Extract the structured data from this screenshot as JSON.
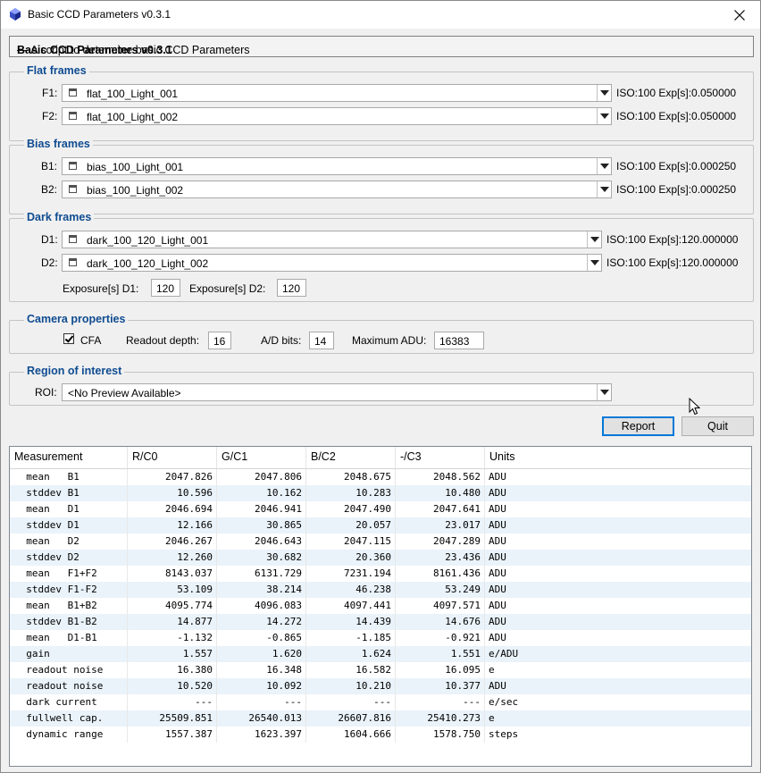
{
  "window": {
    "title": "Basic CCD Parameters v0.3.1"
  },
  "header": {
    "title": "Basic CCD Parameters v0.3.1",
    "dash": " — A script to determine basic CCD Parameters"
  },
  "flat": {
    "title": "Flat frames",
    "rows": [
      {
        "label": "F1:",
        "value": "flat_100_Light_001",
        "info": "ISO:100 Exp[s]:0.050000"
      },
      {
        "label": "F2:",
        "value": "flat_100_Light_002",
        "info": "ISO:100 Exp[s]:0.050000"
      }
    ]
  },
  "bias": {
    "title": "Bias frames",
    "rows": [
      {
        "label": "B1:",
        "value": "bias_100_Light_001",
        "info": "ISO:100 Exp[s]:0.000250"
      },
      {
        "label": "B2:",
        "value": "bias_100_Light_002",
        "info": "ISO:100 Exp[s]:0.000250"
      }
    ]
  },
  "dark": {
    "title": "Dark frames",
    "rows": [
      {
        "label": "D1:",
        "value": "dark_100_120_Light_001",
        "info": "ISO:100 Exp[s]:120.000000"
      },
      {
        "label": "D2:",
        "value": "dark_100_120_Light_002",
        "info": "ISO:100 Exp[s]:120.000000"
      }
    ],
    "exp_d1_label": "Exposure[s] D1:",
    "exp_d1": "120",
    "exp_d2_label": "Exposure[s] D2:",
    "exp_d2": "120"
  },
  "camera": {
    "title": "Camera properties",
    "cfa_label": "CFA",
    "cfa_checked": true,
    "readout_label": "Readout depth:",
    "readout": "16",
    "ad_label": "A/D bits:",
    "ad": "14",
    "maxadu_label": "Maximum ADU:",
    "maxadu": "16383"
  },
  "roi": {
    "title": "Region of interest",
    "label": "ROI:",
    "value": "<No Preview Available>"
  },
  "buttons": {
    "report": "Report",
    "quit": "Quit"
  },
  "table": {
    "headers": [
      "Measurement",
      "R/C0",
      "G/C1",
      "B/C2",
      "-/C3",
      "Units"
    ],
    "rows": [
      [
        "  mean   B1",
        "2047.826",
        "2047.806",
        "2048.675",
        "2048.562",
        "ADU"
      ],
      [
        "  stddev B1",
        "10.596",
        "10.162",
        "10.283",
        "10.480",
        "ADU"
      ],
      [
        "  mean   D1",
        "2046.694",
        "2046.941",
        "2047.490",
        "2047.641",
        "ADU"
      ],
      [
        "  stddev D1",
        "12.166",
        "30.865",
        "20.057",
        "23.017",
        "ADU"
      ],
      [
        "  mean   D2",
        "2046.267",
        "2046.643",
        "2047.115",
        "2047.289",
        "ADU"
      ],
      [
        "  stddev D2",
        "12.260",
        "30.682",
        "20.360",
        "23.436",
        "ADU"
      ],
      [
        "  mean   F1+F2",
        "8143.037",
        "6131.729",
        "7231.194",
        "8161.436",
        "ADU"
      ],
      [
        "  stddev F1-F2",
        "53.109",
        "38.214",
        "46.238",
        "53.249",
        "ADU"
      ],
      [
        "  mean   B1+B2",
        "4095.774",
        "4096.083",
        "4097.441",
        "4097.571",
        "ADU"
      ],
      [
        "  stddev B1-B2",
        "14.877",
        "14.272",
        "14.439",
        "14.676",
        "ADU"
      ],
      [
        "  mean   D1-B1",
        "-1.132",
        "-0.865",
        "-1.185",
        "-0.921",
        "ADU"
      ],
      [
        "  gain",
        "1.557",
        "1.620",
        "1.624",
        "1.551",
        "e/ADU"
      ],
      [
        "  readout noise",
        "16.380",
        "16.348",
        "16.582",
        "16.095",
        "e"
      ],
      [
        "  readout noise",
        "10.520",
        "10.092",
        "10.210",
        "10.377",
        "ADU"
      ],
      [
        "  dark current",
        "---",
        "---",
        "---",
        "---",
        "e/sec"
      ],
      [
        "  fullwell cap.",
        "25509.851",
        "26540.013",
        "26607.816",
        "25410.273",
        "e"
      ],
      [
        "  dynamic range",
        "1557.387",
        "1623.397",
        "1604.666",
        "1578.750",
        "steps"
      ]
    ]
  }
}
